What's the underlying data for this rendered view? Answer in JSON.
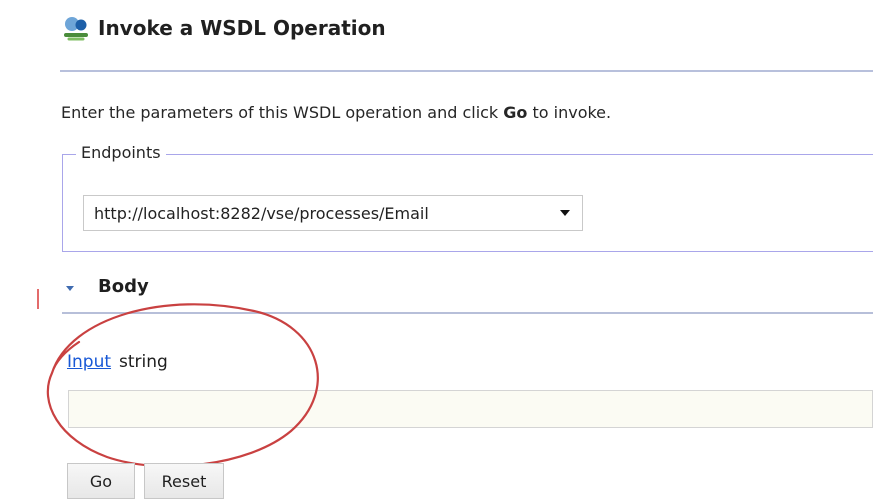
{
  "header": {
    "title": "Invoke a WSDL Operation"
  },
  "instructions": {
    "prefix": "Enter the parameters of this WSDL operation and click ",
    "go_word": "Go",
    "suffix": " to invoke."
  },
  "endpoints": {
    "label": "Endpoints",
    "selected": "http://localhost:8282/vse/processes/Email"
  },
  "body": {
    "label": "Body",
    "input_link": "Input",
    "input_type": "string",
    "input_value": ""
  },
  "buttons": {
    "go": "Go",
    "reset": "Reset"
  }
}
